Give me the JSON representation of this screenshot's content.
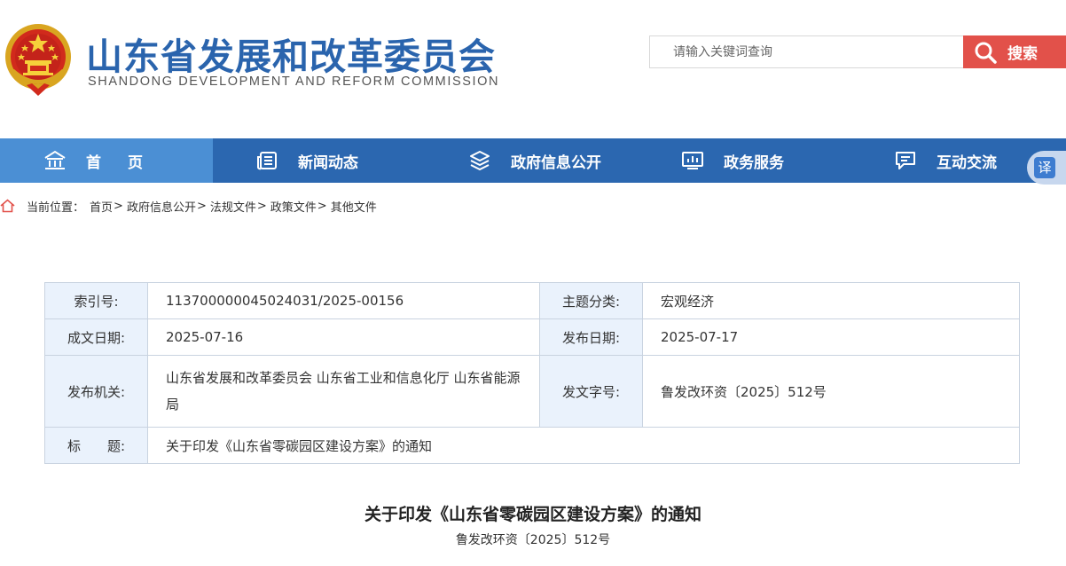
{
  "header": {
    "title": "山东省发展和改革委员会",
    "subtitle": "SHANDONG DEVELOPMENT AND REFORM COMMISSION",
    "emblem_icon": "national-emblem-icon"
  },
  "search": {
    "placeholder": "请输入关键词查询",
    "value": "",
    "button_label": "搜索"
  },
  "nav": {
    "items": [
      {
        "label": "首页",
        "icon": "home-icon"
      },
      {
        "label": "新闻动态",
        "icon": "news-icon"
      },
      {
        "label": "政府信息公开",
        "icon": "layers-icon"
      },
      {
        "label": "政务服务",
        "icon": "chart-icon"
      },
      {
        "label": "互动交流",
        "icon": "chat-icon"
      }
    ]
  },
  "translate": {
    "label": "译"
  },
  "breadcrumb": {
    "prefix": "当前位置：",
    "items": [
      "首页",
      "政府信息公开",
      "法规文件",
      "政策文件",
      "其他文件"
    ],
    "separator": ">"
  },
  "meta": {
    "index_label": "索引号:",
    "index_value": "113700000045024031/2025-00156",
    "topic_label": "主题分类:",
    "topic_value": "宏观经济",
    "date_label": "成文日期:",
    "date_value": "2025-07-16",
    "publish_label": "发布日期:",
    "publish_value": "2025-07-17",
    "org_label": "发布机关:",
    "org_value": "山东省发展和改革委员会 山东省工业和信息化厅 山东省能源局",
    "docno_label": "发文字号:",
    "docno_value": "鲁发改环资〔2025〕512号",
    "title_label": "标　　题:",
    "title_value": "关于印发《山东省零碳园区建设方案》的通知"
  },
  "document": {
    "title": "关于印发《山东省零碳园区建设方案》的通知",
    "number": "鲁发改环资〔2025〕512号"
  },
  "colors": {
    "brand_blue": "#2b67b0",
    "nav_active": "#4b8fd4",
    "search_red": "#e2514a",
    "table_key_bg": "#eaf2fc"
  }
}
